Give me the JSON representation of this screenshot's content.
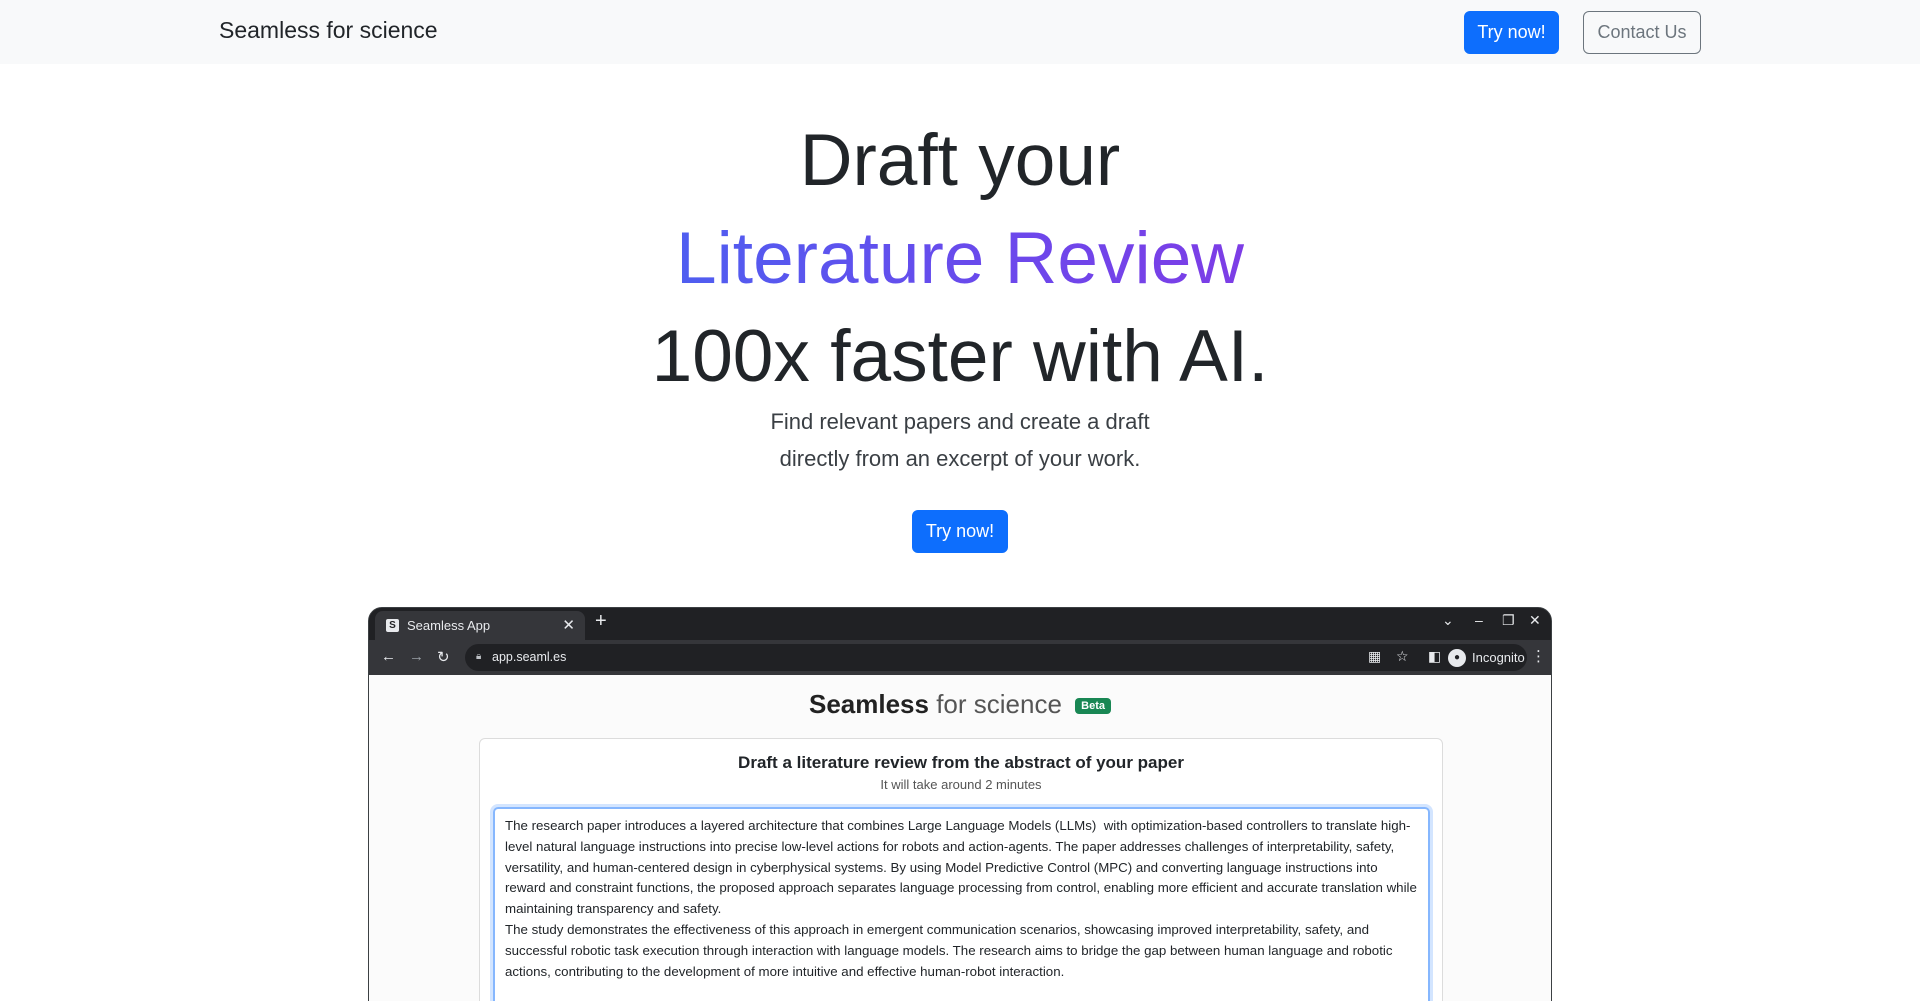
{
  "navbar": {
    "brand": "Seamless for science",
    "try_label": "Try now!",
    "contact_label": "Contact Us"
  },
  "hero": {
    "line1": "Draft your",
    "line2": "Literature Review",
    "line3": "100x faster with AI.",
    "sub_line1": "Find relevant papers and create a draft",
    "sub_line2": "directly from an excerpt of your work.",
    "cta_label": "Try now!"
  },
  "browser": {
    "tab_title": "Seamless App",
    "tab_favicon": "S",
    "url": "app.seaml.es",
    "profile_label": "Incognito",
    "icons": [
      "close-icon",
      "plus-icon",
      "chevron-down-icon",
      "minimize-icon",
      "restore-icon",
      "back-icon",
      "forward-icon",
      "reload-icon",
      "lock-icon",
      "qr-code-icon",
      "star-icon",
      "side-panel-icon",
      "incognito-icon",
      "menu-icon"
    ]
  },
  "app": {
    "logo_bold": "Seamless",
    "logo_light": "for science",
    "beta_label": "Beta",
    "card_title": "Draft a literature review from the abstract of your paper",
    "card_subtitle": "It will take around 2 minutes",
    "abstract_text": "The research paper introduces a layered architecture that combines Large Language Models (LLMs)  with optimization-based controllers to translate high-level natural language instructions into precise low-level actions for robots and action-agents. The paper addresses challenges of interpretability, safety, versatility, and human-centered design in cyberphysical systems. By using Model Predictive Control (MPC) and converting language instructions into reward and constraint functions, the proposed approach separates language processing from control, enabling more efficient and accurate translation while maintaining transparency and safety.\nThe study demonstrates the effectiveness of this approach in emergent communication scenarios, showcasing improved interpretability, safety, and successful robotic task execution through interaction with language models. The research aims to bridge the gap between human language and robotic actions, contributing to the development of more intuitive and effective human-robot interaction."
  },
  "colors": {
    "primary": "#0d6efd",
    "navbar_bg": "#f8f9fa",
    "gradient_start": "#4f5ef0",
    "gradient_end": "#7d3de6",
    "beta_badge": "#198754"
  }
}
